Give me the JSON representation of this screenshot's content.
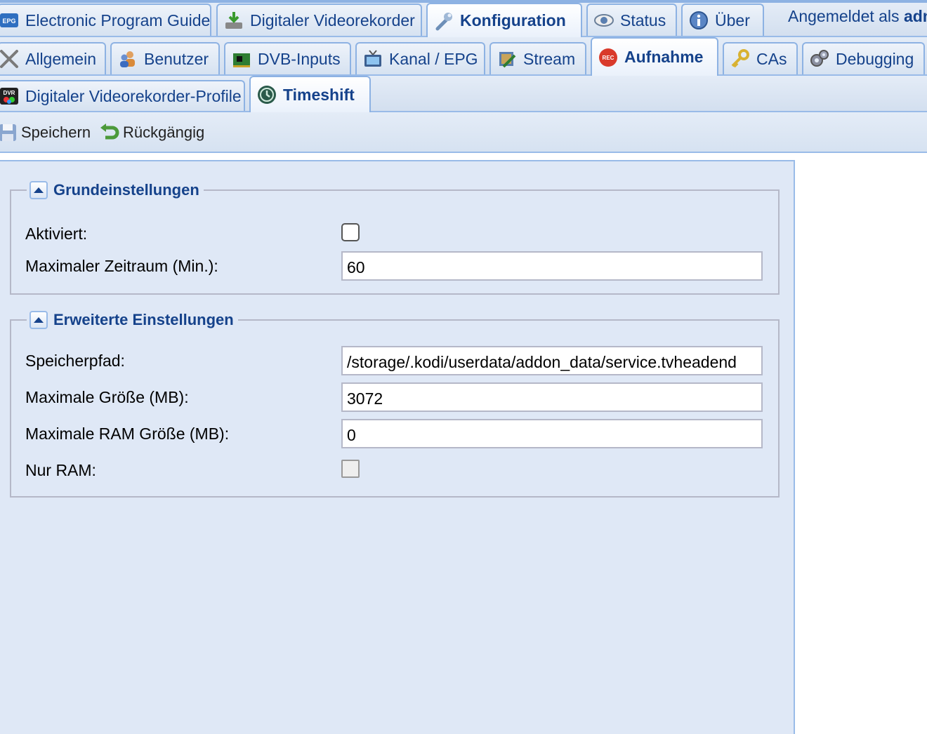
{
  "top_tabs": [
    {
      "label": "Electronic Program Guide",
      "icon": "epg-icon"
    },
    {
      "label": "Digitaler Videorekorder",
      "icon": "download-icon"
    },
    {
      "label": "Konfiguration",
      "icon": "wrench-icon",
      "active": true
    },
    {
      "label": "Status",
      "icon": "eye-icon"
    },
    {
      "label": "Über",
      "icon": "info-icon"
    }
  ],
  "login": {
    "prefix": "Angemeldet als ",
    "user": "adm"
  },
  "config_tabs": [
    {
      "label": "Allgemein",
      "icon": "tools-icon"
    },
    {
      "label": "Benutzer",
      "icon": "users-icon"
    },
    {
      "label": "DVB-Inputs",
      "icon": "card-icon"
    },
    {
      "label": "Kanal / EPG",
      "icon": "tv-icon"
    },
    {
      "label": "Stream",
      "icon": "stream-icon"
    },
    {
      "label": "Aufnahme",
      "icon": "rec-icon",
      "active": true
    },
    {
      "label": "CAs",
      "icon": "key-icon"
    },
    {
      "label": "Debugging",
      "icon": "gears-icon"
    }
  ],
  "sub_tabs": [
    {
      "label": "Digitaler Videorekorder-Profile",
      "icon": "dvr-icon"
    },
    {
      "label": "Timeshift",
      "icon": "timeshift-icon",
      "active": true
    }
  ],
  "toolbar": {
    "save_label": "Speichern",
    "undo_label": "Rückgängig"
  },
  "basic": {
    "title": "Grundeinstellungen",
    "enabled_label": "Aktiviert:",
    "enabled": false,
    "max_period_label": "Maximaler Zeitraum (Min.):",
    "max_period": "60"
  },
  "advanced": {
    "title": "Erweiterte Einstellungen",
    "path_label": "Speicherpfad:",
    "path": "/storage/.kodi/userdata/addon_data/service.tvheadend",
    "max_size_label": "Maximale Größe (MB):",
    "max_size": "3072",
    "max_ram_label": "Maximale RAM Größe (MB):",
    "max_ram": "0",
    "ram_only_label": "Nur RAM:",
    "ram_only": false
  }
}
